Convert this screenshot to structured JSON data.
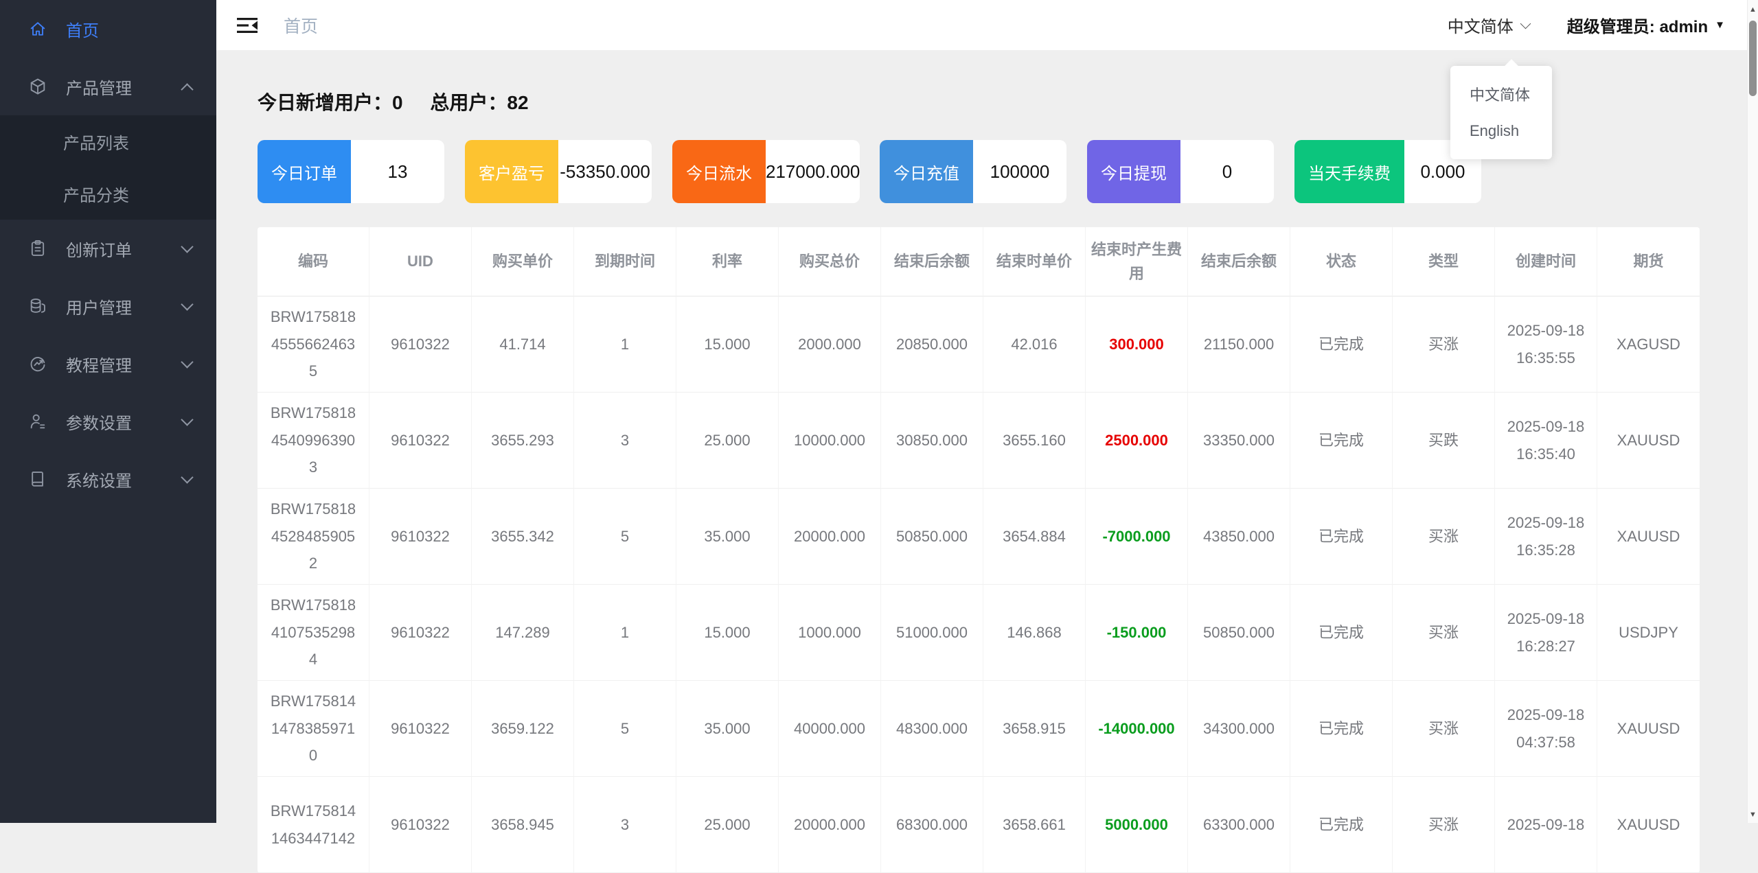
{
  "sidebar": {
    "items": [
      {
        "label": "首页",
        "icon": "home-icon",
        "active": true
      },
      {
        "label": "产品管理",
        "icon": "cube-icon",
        "expanded": true
      },
      {
        "label": "创新订单",
        "icon": "clipboard-icon"
      },
      {
        "label": "用户管理",
        "icon": "coins-icon"
      },
      {
        "label": "教程管理",
        "icon": "trend-circle-icon"
      },
      {
        "label": "参数设置",
        "icon": "user-icon"
      },
      {
        "label": "系统设置",
        "icon": "book-icon"
      }
    ],
    "product_children": [
      {
        "label": "产品列表"
      },
      {
        "label": "产品分类"
      }
    ]
  },
  "header": {
    "breadcrumb": "首页",
    "language_label": "中文简体",
    "admin_label": "超级管理员: admin"
  },
  "language_menu": {
    "items": [
      {
        "label": "中文简体"
      },
      {
        "label": "English"
      }
    ]
  },
  "stats": {
    "new_users_label": "今日新增用户：",
    "new_users_value": "0",
    "total_users_label": "总用户：",
    "total_users_value": "82"
  },
  "cards": [
    {
      "label": "今日订单",
      "value": "13",
      "color": "#2e8df2"
    },
    {
      "label": "客户盈亏",
      "value": "-53350.000",
      "color": "#fdc330"
    },
    {
      "label": "今日流水",
      "value": "217000.000",
      "color": "#f96815"
    },
    {
      "label": "今日充值",
      "value": "100000",
      "color": "#4090dd"
    },
    {
      "label": "今日提现",
      "value": "0",
      "color": "#7065e6"
    },
    {
      "label": "当天手续费",
      "value": "0.000",
      "color": "#0cc57d"
    }
  ],
  "table": {
    "columns": [
      "编码",
      "UID",
      "购买单价",
      "到期时间",
      "利率",
      "购买总价",
      "结束后余额",
      "结束时单价",
      "结束时产生费用",
      "结束后余额",
      "状态",
      "类型",
      "创建时间",
      "期货"
    ],
    "column_keys": [
      "code",
      "uid",
      "buy-price",
      "expire-time",
      "rate",
      "buy-total",
      "end-balance",
      "end-unit-price",
      "end-fee",
      "end-balance2",
      "status",
      "type",
      "created-at",
      "futures"
    ],
    "fee_colors": {
      "red": "#e60000",
      "green": "#0a9d1e"
    },
    "rows": [
      {
        "cells": [
          "BRW17581845556624635",
          "9610322",
          "41.714",
          "1",
          "15.000",
          "2000.000",
          "20850.000",
          "42.016",
          "300.000",
          "21150.000",
          "已完成",
          "买涨",
          "2025-09-18 16:35:55",
          "XAGUSD"
        ],
        "fee_color": "#e60000"
      },
      {
        "cells": [
          "BRW17581845409963903",
          "9610322",
          "3655.293",
          "3",
          "25.000",
          "10000.000",
          "30850.000",
          "3655.160",
          "2500.000",
          "33350.000",
          "已完成",
          "买跌",
          "2025-09-18 16:35:40",
          "XAUUSD"
        ],
        "fee_color": "#e60000"
      },
      {
        "cells": [
          "BRW17581845284859052",
          "9610322",
          "3655.342",
          "5",
          "35.000",
          "20000.000",
          "50850.000",
          "3654.884",
          "-7000.000",
          "43850.000",
          "已完成",
          "买涨",
          "2025-09-18 16:35:28",
          "XAUUSD"
        ],
        "fee_color": "#0a9d1e"
      },
      {
        "cells": [
          "BRW17581841075352984",
          "9610322",
          "147.289",
          "1",
          "15.000",
          "1000.000",
          "51000.000",
          "146.868",
          "-150.000",
          "50850.000",
          "已完成",
          "买涨",
          "2025-09-18 16:28:27",
          "USDJPY"
        ],
        "fee_color": "#0a9d1e"
      },
      {
        "cells": [
          "BRW17581414783859710",
          "9610322",
          "3659.122",
          "5",
          "35.000",
          "40000.000",
          "48300.000",
          "3658.915",
          "-14000.000",
          "34300.000",
          "已完成",
          "买涨",
          "2025-09-18 04:37:58",
          "XAUUSD"
        ],
        "fee_color": "#0a9d1e"
      },
      {
        "cells": [
          "BRW1758141463447142",
          "9610322",
          "3658.945",
          "3",
          "25.000",
          "20000.000",
          "68300.000",
          "3658.661",
          "5000.000",
          "63300.000",
          "已完成",
          "买涨",
          "2025-09-18",
          "XAUUSD"
        ],
        "fee_color": "#0a9d1e"
      }
    ]
  }
}
